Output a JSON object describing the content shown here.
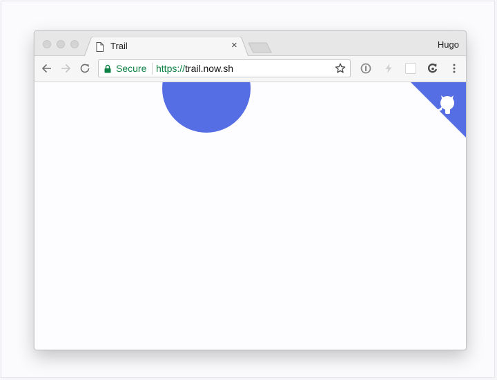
{
  "tab": {
    "title": "Trail",
    "close_glyph": "×",
    "favicon": "page-icon"
  },
  "profile": {
    "name": "Hugo"
  },
  "omnibox": {
    "security_label": "Secure",
    "url_scheme": "https://",
    "url_host": "trail.now.sh"
  },
  "icons": {
    "back": "back-arrow-icon",
    "forward": "forward-arrow-icon",
    "reload": "reload-icon",
    "lock": "lock-icon",
    "star": "bookmark-star-icon",
    "ext1": "onepassword-icon",
    "ext2": "lightning-icon",
    "ext3": "blank-extension-icon",
    "ext4": "refresh-swirl-icon",
    "menu": "kebab-menu-icon",
    "corner": "github-octocat-icon"
  },
  "colors": {
    "accent": "#566ee3",
    "secure_green": "#0b8043",
    "page_bg": "#fdfcff"
  }
}
